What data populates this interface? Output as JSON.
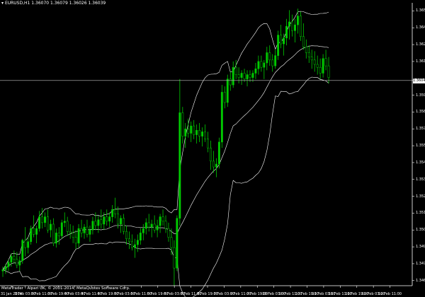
{
  "header": {
    "symbol": "EURUSD,H1",
    "ohlc": "1.36070 1.36079 1.36026 1.36039"
  },
  "copyright": "MetaTrader - Alpari UK, © 2001-2014, MetaQuotes Software Corp.",
  "current_price_label": "1.36040",
  "colors": {
    "background": "#000000",
    "bull_candle": "#00cc00",
    "bear_candle": "#000000",
    "wick": "#00cc00",
    "bands": "#ffffff",
    "axis": "#ffffff",
    "price_line": "#c0c0c0"
  },
  "chart_data": {
    "type": "candlestick",
    "indicator": "bollinger-bands",
    "y_ticks": [
      "1.36515",
      "1.36400",
      "1.36285",
      "1.36170",
      "1.36040",
      "1.35940",
      "1.35825",
      "1.35710",
      "1.35595",
      "1.35480",
      "1.35365",
      "1.35250",
      "1.35135",
      "1.35020",
      "1.34905",
      "1.34790",
      "1.34675"
    ],
    "x_ticks": [
      "31 Jan 2014",
      "3 Feb 03:00",
      "3 Feb 11:00",
      "3 Feb 19:00",
      "4 Feb 03:00",
      "4 Feb 11:00",
      "4 Feb 19:00",
      "5 Feb 03:00",
      "5 Feb 11:00",
      "5 Feb 19:00",
      "6 Feb 03:00",
      "6 Feb 11:00",
      "6 Feb 19:00",
      "7 Feb 03:00",
      "7 Feb 11:00",
      "7 Feb 19:00",
      "10 Feb 03:00",
      "10 Feb 11:00",
      "10 Feb 19:00",
      "11 Feb 03:00",
      "11 Feb 11:00",
      "11 Feb 19:00",
      "12 Feb 03:00",
      "12 Feb 11:00"
    ],
    "current_price": 1.3604,
    "ylim": [
      1.3464,
      1.3657
    ],
    "candles": [
      [
        1.3474,
        1.3477,
        1.347,
        1.3475
      ],
      [
        1.3475,
        1.3479,
        1.3472,
        1.3477
      ],
      [
        1.3477,
        1.3482,
        1.3474,
        1.348
      ],
      [
        1.348,
        1.3486,
        1.3477,
        1.3484
      ],
      [
        1.3484,
        1.3488,
        1.3479,
        1.3482
      ],
      [
        1.3482,
        1.3487,
        1.3476,
        1.3478
      ],
      [
        1.3478,
        1.3484,
        1.3474,
        1.3481
      ],
      [
        1.3481,
        1.3496,
        1.3479,
        1.3495
      ],
      [
        1.3495,
        1.3504,
        1.3484,
        1.349
      ],
      [
        1.349,
        1.3497,
        1.3486,
        1.3494
      ],
      [
        1.3494,
        1.3505,
        1.3492,
        1.3503
      ],
      [
        1.3503,
        1.3512,
        1.3497,
        1.3499
      ],
      [
        1.3499,
        1.3505,
        1.3493,
        1.3503
      ],
      [
        1.3503,
        1.3515,
        1.3501,
        1.3511
      ],
      [
        1.3511,
        1.3517,
        1.3503,
        1.3507
      ],
      [
        1.3507,
        1.3514,
        1.3504,
        1.3511
      ],
      [
        1.3511,
        1.3516,
        1.35,
        1.3502
      ],
      [
        1.3502,
        1.3509,
        1.3497,
        1.3506
      ],
      [
        1.3506,
        1.351,
        1.3491,
        1.3493
      ],
      [
        1.3493,
        1.3503,
        1.349,
        1.35
      ],
      [
        1.35,
        1.3504,
        1.3492,
        1.3498
      ],
      [
        1.3498,
        1.3509,
        1.3496,
        1.3507
      ],
      [
        1.3507,
        1.3514,
        1.3504,
        1.3508
      ],
      [
        1.3508,
        1.3511,
        1.3498,
        1.3501
      ],
      [
        1.3501,
        1.3506,
        1.3496,
        1.35
      ],
      [
        1.35,
        1.3505,
        1.3493,
        1.3497
      ],
      [
        1.3497,
        1.3502,
        1.3489,
        1.3493
      ],
      [
        1.3493,
        1.3506,
        1.349,
        1.3503
      ],
      [
        1.3503,
        1.3509,
        1.3497,
        1.35
      ],
      [
        1.35,
        1.3506,
        1.3496,
        1.3504
      ],
      [
        1.3504,
        1.3509,
        1.3497,
        1.3499
      ],
      [
        1.3499,
        1.3505,
        1.3494,
        1.3502
      ],
      [
        1.3502,
        1.3511,
        1.3499,
        1.3508
      ],
      [
        1.3508,
        1.3514,
        1.3502,
        1.3505
      ],
      [
        1.3505,
        1.3512,
        1.35,
        1.3509
      ],
      [
        1.3509,
        1.3516,
        1.3503,
        1.3506
      ],
      [
        1.3506,
        1.3514,
        1.3502,
        1.3511
      ],
      [
        1.3511,
        1.3516,
        1.3505,
        1.3508
      ],
      [
        1.3508,
        1.3514,
        1.3504,
        1.3511
      ],
      [
        1.3511,
        1.3519,
        1.3507,
        1.3516
      ],
      [
        1.3516,
        1.3524,
        1.351,
        1.3513
      ],
      [
        1.3513,
        1.3518,
        1.3503,
        1.3506
      ],
      [
        1.3506,
        1.3512,
        1.35,
        1.351
      ],
      [
        1.351,
        1.3513,
        1.3499,
        1.3501
      ],
      [
        1.3501,
        1.3505,
        1.3492,
        1.3496
      ],
      [
        1.3496,
        1.3501,
        1.3489,
        1.3494
      ],
      [
        1.3494,
        1.3499,
        1.3488,
        1.349
      ],
      [
        1.349,
        1.3496,
        1.3483,
        1.3492
      ],
      [
        1.3492,
        1.3499,
        1.3487,
        1.3495
      ],
      [
        1.3495,
        1.3503,
        1.3492,
        1.35
      ],
      [
        1.35,
        1.3506,
        1.3495,
        1.3503
      ],
      [
        1.3503,
        1.351,
        1.3499,
        1.3507
      ],
      [
        1.3507,
        1.3513,
        1.3501,
        1.3504
      ],
      [
        1.3504,
        1.3509,
        1.3497,
        1.3506
      ],
      [
        1.3506,
        1.3512,
        1.35,
        1.3502
      ],
      [
        1.3502,
        1.3509,
        1.3497,
        1.3505
      ],
      [
        1.3505,
        1.3513,
        1.35,
        1.3511
      ],
      [
        1.3511,
        1.3516,
        1.3505,
        1.3508
      ],
      [
        1.3508,
        1.3512,
        1.35,
        1.3503
      ],
      [
        1.3503,
        1.3507,
        1.3494,
        1.3497
      ],
      [
        1.3497,
        1.3503,
        1.3485,
        1.349
      ],
      [
        1.349,
        1.3495,
        1.3464,
        1.3476
      ],
      [
        1.3476,
        1.3512,
        1.3474,
        1.351
      ],
      [
        1.351,
        1.3605,
        1.3505,
        1.3582
      ],
      [
        1.3582,
        1.3586,
        1.3561,
        1.3566
      ],
      [
        1.3566,
        1.3575,
        1.3558,
        1.3571
      ],
      [
        1.3571,
        1.3578,
        1.3565,
        1.3568
      ],
      [
        1.3568,
        1.3576,
        1.3562,
        1.3573
      ],
      [
        1.3573,
        1.3577,
        1.3564,
        1.3567
      ],
      [
        1.3567,
        1.3574,
        1.3561,
        1.357
      ],
      [
        1.357,
        1.3575,
        1.3562,
        1.3566
      ],
      [
        1.3566,
        1.3572,
        1.3559,
        1.3569
      ],
      [
        1.3569,
        1.3574,
        1.3562,
        1.3564
      ],
      [
        1.3564,
        1.3569,
        1.3555,
        1.3558
      ],
      [
        1.3558,
        1.3563,
        1.3543,
        1.3549
      ],
      [
        1.3549,
        1.3556,
        1.3541,
        1.3545
      ],
      [
        1.3545,
        1.3551,
        1.3538,
        1.3547
      ],
      [
        1.3547,
        1.3565,
        1.3544,
        1.3562
      ],
      [
        1.3562,
        1.3601,
        1.3558,
        1.3596
      ],
      [
        1.3596,
        1.36,
        1.3585,
        1.3589
      ],
      [
        1.3589,
        1.3608,
        1.3586,
        1.3605
      ],
      [
        1.3605,
        1.361,
        1.3597,
        1.3601
      ],
      [
        1.3601,
        1.3617,
        1.3599,
        1.3613
      ],
      [
        1.3613,
        1.3618,
        1.3605,
        1.3608
      ],
      [
        1.3608,
        1.3613,
        1.3602,
        1.3606
      ],
      [
        1.3606,
        1.3611,
        1.3601,
        1.3609
      ],
      [
        1.3609,
        1.3612,
        1.3603,
        1.3605
      ],
      [
        1.3605,
        1.3611,
        1.36,
        1.3608
      ],
      [
        1.3608,
        1.3611,
        1.3603,
        1.3606
      ],
      [
        1.3606,
        1.3611,
        1.3603,
        1.3609
      ],
      [
        1.3609,
        1.3616,
        1.3605,
        1.3612
      ],
      [
        1.3612,
        1.3621,
        1.3608,
        1.3617
      ],
      [
        1.3617,
        1.3621,
        1.361,
        1.3613
      ],
      [
        1.3613,
        1.3618,
        1.3605,
        1.3616
      ],
      [
        1.3616,
        1.3627,
        1.3611,
        1.3623
      ],
      [
        1.3623,
        1.3628,
        1.3614,
        1.3618
      ],
      [
        1.3618,
        1.3622,
        1.361,
        1.3614
      ],
      [
        1.3614,
        1.3625,
        1.3612,
        1.3621
      ],
      [
        1.3621,
        1.3638,
        1.3618,
        1.3635
      ],
      [
        1.3635,
        1.3642,
        1.3626,
        1.3629
      ],
      [
        1.3629,
        1.3636,
        1.3621,
        1.3633
      ],
      [
        1.3633,
        1.3646,
        1.3628,
        1.3641
      ],
      [
        1.3641,
        1.3652,
        1.3632,
        1.3644
      ],
      [
        1.3644,
        1.3649,
        1.3634,
        1.3638
      ],
      [
        1.3638,
        1.3646,
        1.363,
        1.3642
      ],
      [
        1.3642,
        1.3653,
        1.3636,
        1.3648
      ],
      [
        1.3648,
        1.3651,
        1.3631,
        1.3634
      ],
      [
        1.3634,
        1.3643,
        1.3625,
        1.3627
      ],
      [
        1.3627,
        1.3632,
        1.3619,
        1.3623
      ],
      [
        1.3623,
        1.3628,
        1.3616,
        1.362
      ],
      [
        1.362,
        1.3625,
        1.3612,
        1.3618
      ],
      [
        1.3618,
        1.3624,
        1.361,
        1.3615
      ],
      [
        1.3615,
        1.3621,
        1.3608,
        1.3613
      ],
      [
        1.3613,
        1.3619,
        1.3605,
        1.3609
      ],
      [
        1.3609,
        1.3622,
        1.3606,
        1.3619
      ],
      [
        1.3619,
        1.3625,
        1.3611,
        1.3614
      ],
      [
        1.3614,
        1.362,
        1.3602,
        1.3606
      ]
    ]
  }
}
